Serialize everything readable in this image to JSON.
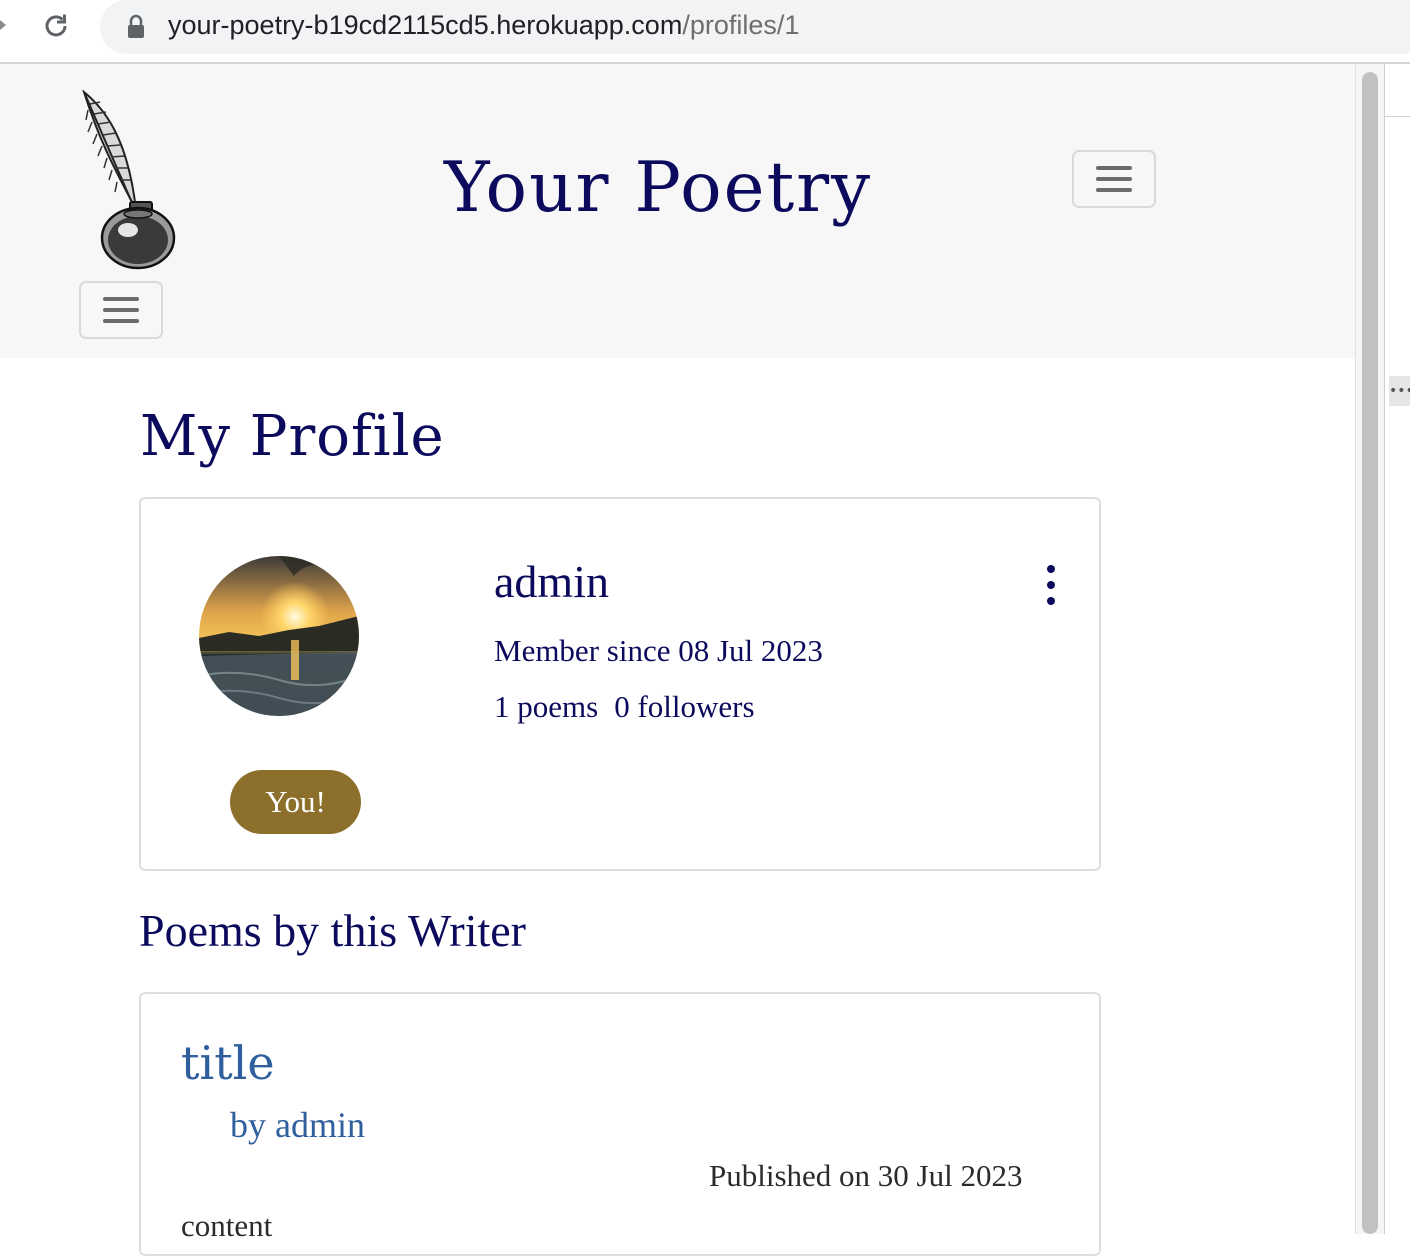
{
  "browser": {
    "url_domain": "your-poetry-b19cd2115cd5.herokuapp.com",
    "url_path": "/profiles/1"
  },
  "navbar": {
    "site_title": "Your Poetry"
  },
  "page": {
    "heading": "My Profile"
  },
  "profile": {
    "username": "admin",
    "member_since": "Member since 08 Jul 2023",
    "poems_count": "1 poems",
    "followers_count": "0 followers",
    "badge": "You!"
  },
  "poems_section": {
    "heading": "Poems by this Writer",
    "items": [
      {
        "title": "title",
        "author": "by admin",
        "published": "Published on 30 Jul 2023",
        "content": "content"
      }
    ]
  },
  "colors": {
    "primary_text": "#0b0a5c",
    "link": "#2f5f9c",
    "badge": "#8c6f2b"
  }
}
